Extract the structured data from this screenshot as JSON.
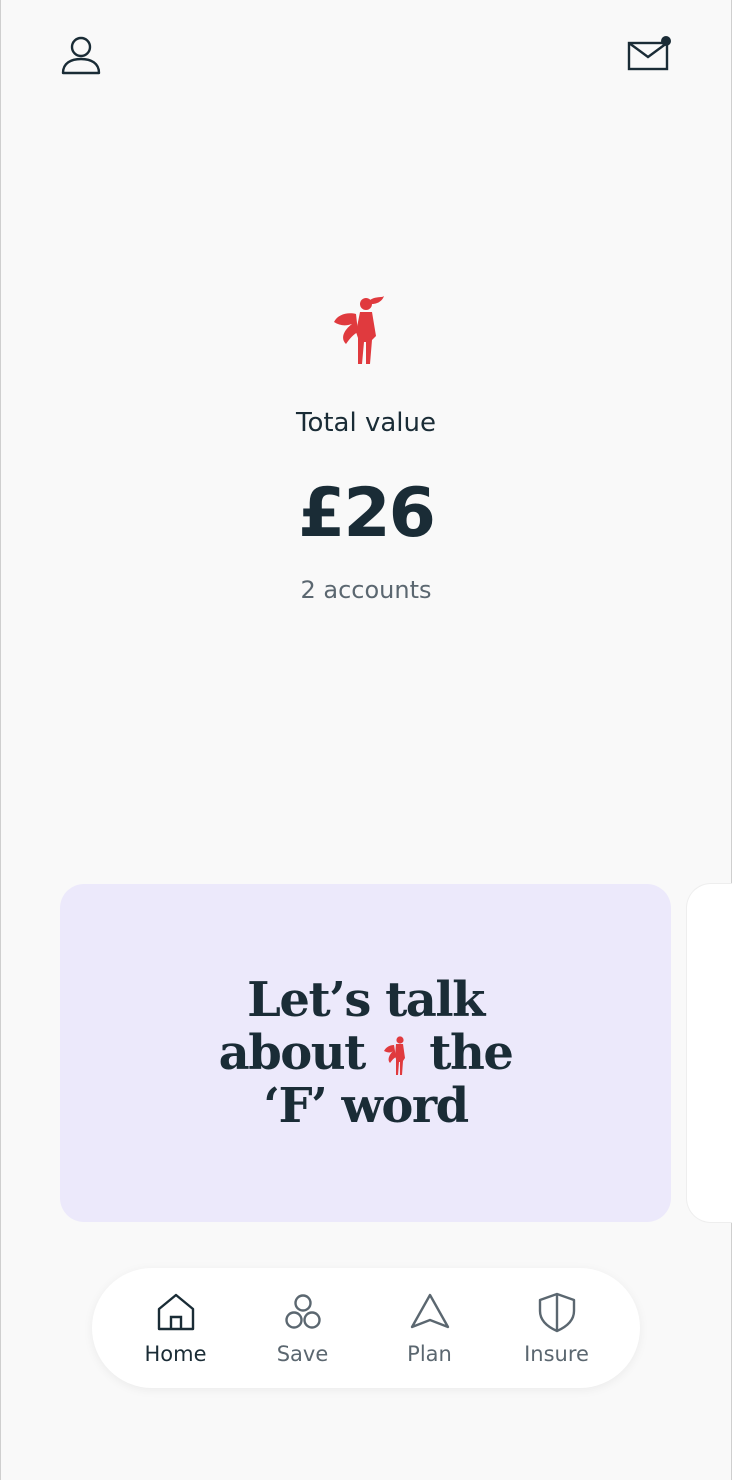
{
  "header": {
    "profile_icon": "user-icon",
    "inbox_icon": "mail-icon",
    "has_unread": true
  },
  "summary": {
    "label": "Total value",
    "amount": "£26",
    "accounts": "2 accounts"
  },
  "promo": {
    "line1": "Let’s talk",
    "line2_pre": "about",
    "line2_post": "the",
    "line3": "‘F’ word"
  },
  "nav": {
    "items": [
      {
        "label": "Home",
        "icon": "home-icon",
        "active": true
      },
      {
        "label": "Save",
        "icon": "circles-icon",
        "active": false
      },
      {
        "label": "Plan",
        "icon": "triangle-icon",
        "active": false
      },
      {
        "label": "Insure",
        "icon": "shield-icon",
        "active": false
      }
    ]
  },
  "colors": {
    "accent": "#e03a3e",
    "text": "#1a2c36",
    "card": "#ece9fb",
    "background": "#f9f9f9"
  }
}
